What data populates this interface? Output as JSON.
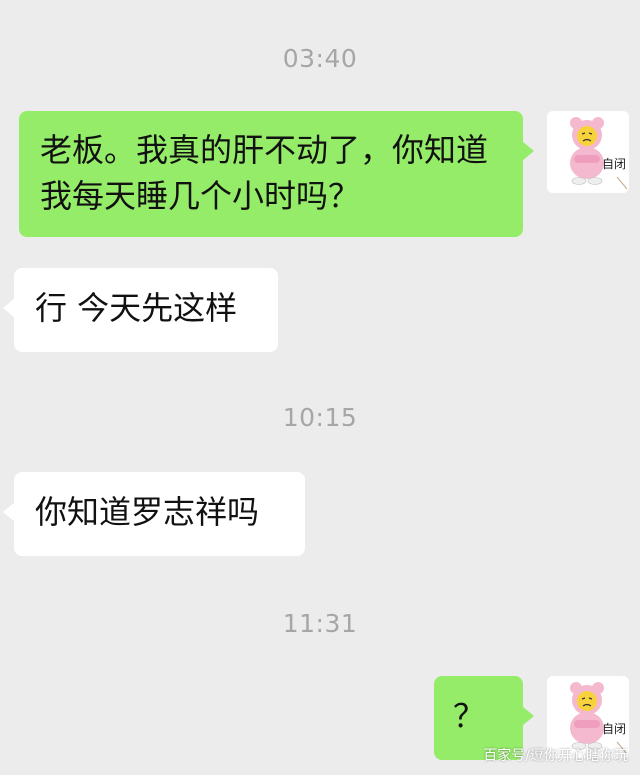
{
  "messages": [
    {
      "time": "03:40"
    },
    {
      "text": "老板。我真的肝不动了，你知道我每天睡几个小时吗？"
    },
    {
      "text": "行 今天先这样"
    },
    {
      "time": "10:15"
    },
    {
      "text": "你知道罗志祥吗"
    },
    {
      "time": "11:31"
    },
    {
      "text": "？"
    }
  ],
  "avatar": {
    "label": "自闭"
  },
  "watermark": "百家号/逗你开心瞎你玩",
  "colors": {
    "my_bubble": "#95ec69",
    "other_bubble": "#ffffff",
    "background": "#ececec",
    "timestamp": "#a6a6a6"
  }
}
